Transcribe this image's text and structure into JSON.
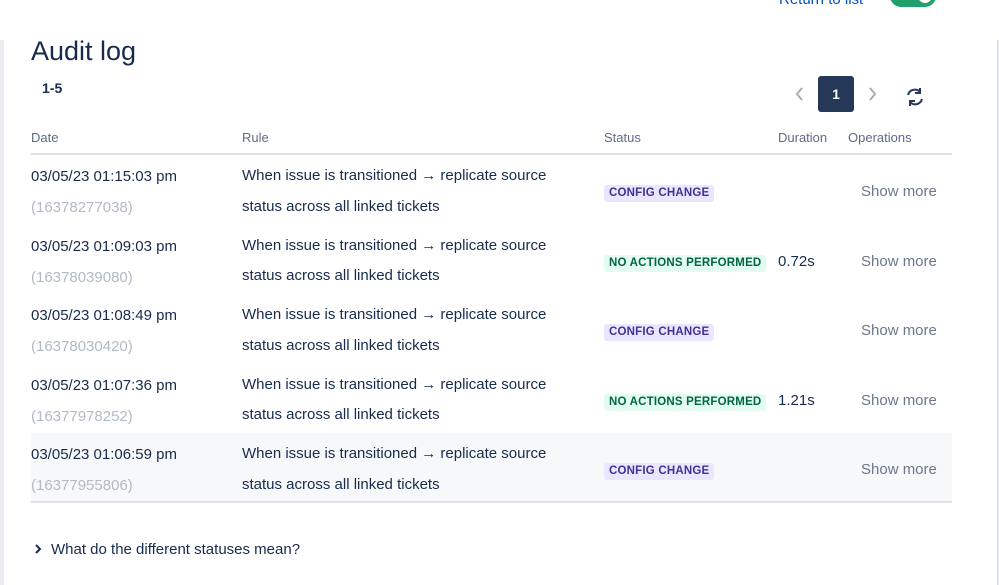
{
  "header": {
    "return_label": "Return to list",
    "toggle_on": true
  },
  "page": {
    "title": "Audit log",
    "range": "1-5"
  },
  "pagination": {
    "prev_icon": "chevron-left-icon",
    "current_page": "1",
    "next_icon": "chevron-right-icon",
    "refresh_icon": "refresh-icon"
  },
  "table": {
    "columns": [
      "Date",
      "Rule",
      "Status",
      "Duration",
      "Operations"
    ],
    "rows": [
      {
        "date": "03/05/23 01:15:03 pm",
        "id": "(16378277038)",
        "rule": "When issue is transitioned → replicate source status across all linked tickets",
        "status": "CONFIG CHANGE",
        "status_type": "config",
        "duration": "",
        "operation": "Show more"
      },
      {
        "date": "03/05/23 01:09:03 pm",
        "id": "(16378039080)",
        "rule": "When issue is transitioned → replicate source status across all linked tickets",
        "status": "NO ACTIONS PERFORMED",
        "status_type": "noact",
        "duration": "0.72s",
        "operation": "Show more"
      },
      {
        "date": "03/05/23 01:08:49 pm",
        "id": "(16378030420)",
        "rule": "When issue is transitioned → replicate source status across all linked tickets",
        "status": "CONFIG CHANGE",
        "status_type": "config",
        "duration": "",
        "operation": "Show more"
      },
      {
        "date": "03/05/23 01:07:36 pm",
        "id": "(16377978252)",
        "rule": "When issue is transitioned → replicate source status across all linked tickets",
        "status": "NO ACTIONS PERFORMED",
        "status_type": "noact",
        "duration": "1.21s",
        "operation": "Show more"
      },
      {
        "date": "03/05/23 01:06:59 pm",
        "id": "(16377955806)",
        "rule": "When issue is transitioned → replicate source status across all linked tickets",
        "status": "CONFIG CHANGE",
        "status_type": "config",
        "duration": "",
        "operation": "Show more"
      }
    ]
  },
  "faq": {
    "label": "What do the different statuses mean?",
    "icon": "chevron-right-icon"
  },
  "colors": {
    "primary_text": "#172b4d",
    "config_bg": "#eae6ff",
    "config_text": "#403294",
    "noact_bg": "#e3fcef",
    "noact_text": "#006644",
    "toggle": "#22a06b",
    "page_active": "#253858"
  }
}
